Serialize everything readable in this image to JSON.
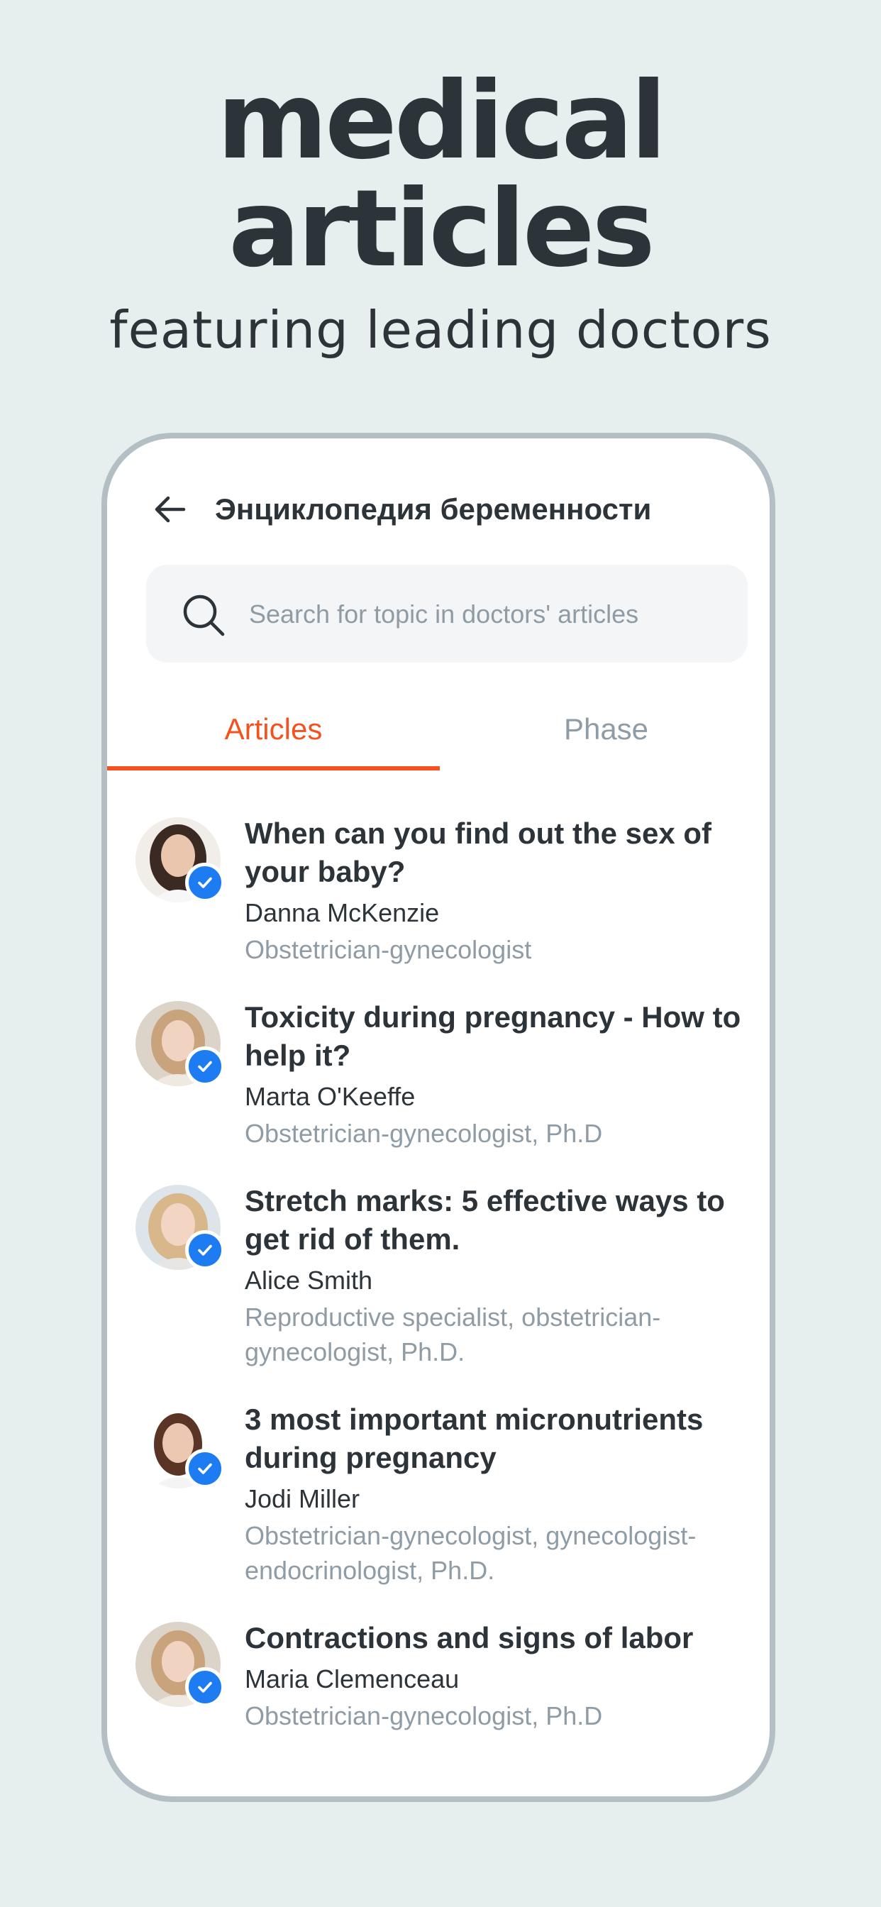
{
  "promo": {
    "headline_line1": "medical",
    "headline_line2": "articles",
    "subheadline": "featuring leading doctors"
  },
  "header": {
    "back_icon": "arrow-left-icon",
    "title": "Энциклопедия беременности"
  },
  "search": {
    "icon": "search-icon",
    "placeholder": "Search for topic in doctors' articles",
    "value": ""
  },
  "tabs": [
    {
      "label": "Articles",
      "active": true
    },
    {
      "label": "Phase",
      "active": false
    }
  ],
  "articles": [
    {
      "title": "When can you find out the sex of your baby?",
      "author": "Danna McKenzie",
      "role": "Obstetrician-gynecologist",
      "verified_icon": "checkmark-badge-icon"
    },
    {
      "title": "Toxicity during pregnancy - How to help it?",
      "author": "Marta O'Keeffe",
      "role": "Obstetrician-gynecologist, Ph.D",
      "verified_icon": "checkmark-badge-icon"
    },
    {
      "title": "Stretch marks: 5 effective ways to get rid of them.",
      "author": "Alice Smith",
      "role": "Reproductive specialist, obstetrician-gynecologist, Ph.D.",
      "verified_icon": "checkmark-badge-icon"
    },
    {
      "title": "3 most important micronutrients during pregnancy",
      "author": "Jodi Miller",
      "role": "Obstetrician-gynecologist, gynecologist-endocrinologist, Ph.D.",
      "verified_icon": "checkmark-badge-icon"
    },
    {
      "title": "Contractions and signs of labor",
      "author": "Maria Clemenceau",
      "role": "Obstetrician-gynecologist, Ph.D",
      "verified_icon": "checkmark-badge-icon"
    }
  ],
  "colors": {
    "background": "#e7efee",
    "accent": "#f4511e",
    "text": "#2d3439",
    "muted": "#8f9ca6",
    "verified": "#1d7cf2"
  }
}
